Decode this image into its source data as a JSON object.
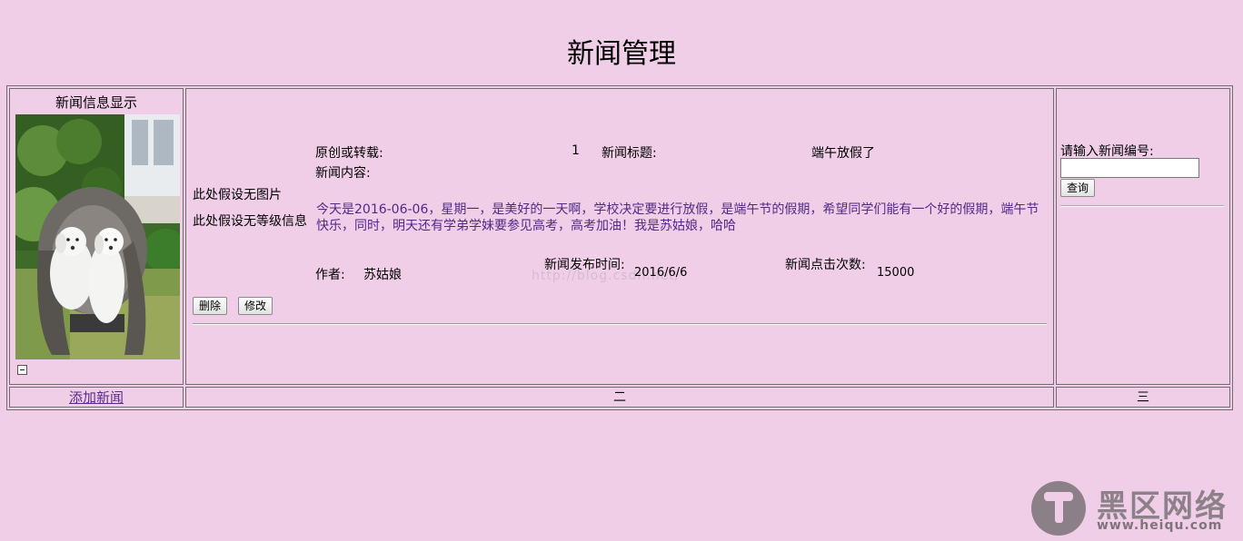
{
  "page": {
    "title": "新闻管理"
  },
  "left_panel": {
    "heading": "新闻信息显示",
    "add_link": "添加新闻"
  },
  "news": {
    "no_image_text": "此处假设无图片",
    "no_level_text": "此处假设无等级信息",
    "origin_label": "原创或转载:",
    "origin_value": "1",
    "title_label": "新闻标题:",
    "title_value": "端午放假了",
    "content_label": "新闻内容:",
    "content_text": "今天是2016-06-06，星期一，是美好的一天啊，学校决定要进行放假，是端午节的假期，希望同学们能有一个好的假期，端午节快乐，同时，明天还有学弟学妹要参见高考，高考加油！我是苏姑娘，哈哈",
    "author_label": "作者:",
    "author_value": "苏姑娘",
    "pubtime_label": "新闻发布时间:",
    "pubtime_value": "2016/6/6",
    "clicks_label": "新闻点击次数:",
    "clicks_value": "15000",
    "delete_label": "删除",
    "edit_label": "修改"
  },
  "search": {
    "label": "请输入新闻编号:",
    "input_value": "",
    "button_label": "查询"
  },
  "footer_row": {
    "middle": "二",
    "right": "三"
  },
  "watermark": {
    "url_text": "http://blog.csdn.net/",
    "site_name": "黑区网络",
    "site_url": "www.heiqu.com"
  },
  "colors": {
    "background": "#f0cee8",
    "content_text": "#4f2a86",
    "link": "#5a2b8a"
  }
}
